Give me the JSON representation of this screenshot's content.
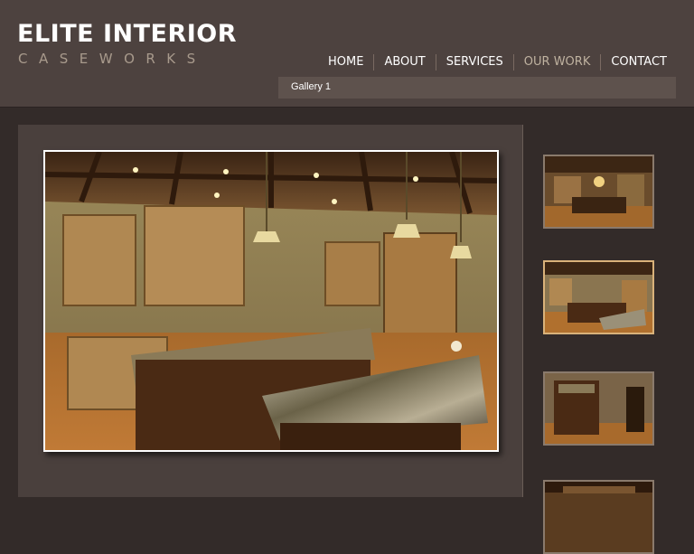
{
  "header": {
    "logo_title": "ELITE INTERIOR",
    "logo_subtitle": "CASEWORKS",
    "nav": [
      {
        "label": "HOME"
      },
      {
        "label": "ABOUT"
      },
      {
        "label": "SERVICES"
      },
      {
        "label": "OUR WORK",
        "active": true
      },
      {
        "label": "CONTACT"
      }
    ],
    "breadcrumb": "Gallery 1"
  },
  "gallery": {
    "selected_index": 1,
    "thumbnail_count_visible": 4
  },
  "colors": {
    "header_bg": "#4d423f",
    "page_bg": "#332b29",
    "panel_bg": "#4a403d",
    "active_nav": "#bfb2a0",
    "thumb_border": "#8a7a6c",
    "thumb_selected_border": "#d9b27a"
  }
}
